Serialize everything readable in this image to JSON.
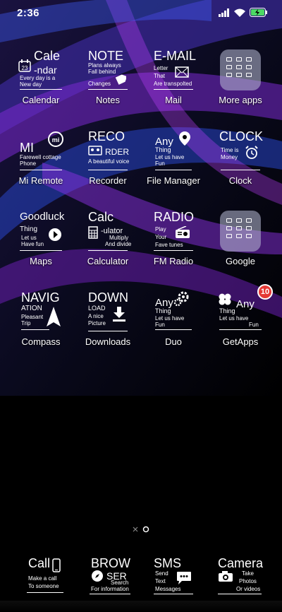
{
  "status": {
    "time": "2:36"
  },
  "apps": [
    {
      "id": "calendar",
      "big": "Cale",
      "big2": "-ndar",
      "l1": "Every day is a",
      "l2": "New day",
      "label": "Calendar"
    },
    {
      "id": "notes",
      "big": "NOTE",
      "l1": "Plans always",
      "l2": "Fall behind",
      "l3": "Changes",
      "label": "Notes"
    },
    {
      "id": "mail",
      "big": "E-MAIL",
      "l1": "Letter",
      "l2": "That",
      "l3": "Are transpolted",
      "label": "Mail"
    },
    {
      "id": "more-apps",
      "label": "More apps"
    },
    {
      "id": "mi-remote",
      "big": "MI",
      "l1": "Farewell cottage",
      "l2": "Phone",
      "label": "Mi Remote"
    },
    {
      "id": "recorder",
      "big": "RECO",
      "big2": "RDER",
      "l1": "A beautiful voice",
      "label": "Recorder"
    },
    {
      "id": "file-manager",
      "big": "Any",
      "l1": "Thing",
      "l2": "Let us have",
      "l3": "Fun",
      "label": "File Manager"
    },
    {
      "id": "clock",
      "big": "CLOCK",
      "l1": "Time is",
      "l2": "Money",
      "label": "Clock"
    },
    {
      "id": "maps",
      "big": "Goodluck",
      "l1": "Thing",
      "l2": "Let us",
      "l3": "Have fun",
      "label": "Maps"
    },
    {
      "id": "calculator",
      "big": "Calc",
      "big2": "-ulator",
      "l1": "Multiply",
      "l2": "And divide",
      "label": "Calculator"
    },
    {
      "id": "fm-radio",
      "big": "RADIO",
      "l1": "Play",
      "l2": "Your",
      "l3": "Fave tunes",
      "label": "FM Radio"
    },
    {
      "id": "google",
      "label": "Google"
    },
    {
      "id": "compass",
      "big": "NAVIG",
      "l1": "ATION",
      "l2": "Pleasant",
      "l3": "Trip",
      "label": "Compass"
    },
    {
      "id": "downloads",
      "big": "DOWN",
      "l1": "LOAD",
      "l2": "A nice",
      "l3": "Picture",
      "label": "Downloads"
    },
    {
      "id": "duo",
      "big": "Any",
      "l1": "Thing",
      "l2": "Let us have",
      "l3": "Fun",
      "label": "Duo"
    },
    {
      "id": "getapps",
      "big": "Any",
      "l1": "Thing",
      "l2": "Let us have",
      "l3": "Fun",
      "badge": "10",
      "label": "GetApps"
    }
  ],
  "dock": [
    {
      "id": "call",
      "big": "Call",
      "l1": "Make a call",
      "l2": "To someone"
    },
    {
      "id": "browser",
      "big": "BROW",
      "big2": "SER",
      "l1": "Search",
      "l2": "For information"
    },
    {
      "id": "sms",
      "big": "SMS",
      "l1": "Send",
      "l2": "Text",
      "l3": "Messages"
    },
    {
      "id": "camera",
      "big": "Camera",
      "l1": "Take",
      "l2": "Photos",
      "l3": "Or videos"
    }
  ],
  "colors": {
    "accent": "#5b3cff",
    "badge": "#e53935",
    "battery": "#4cd964"
  }
}
